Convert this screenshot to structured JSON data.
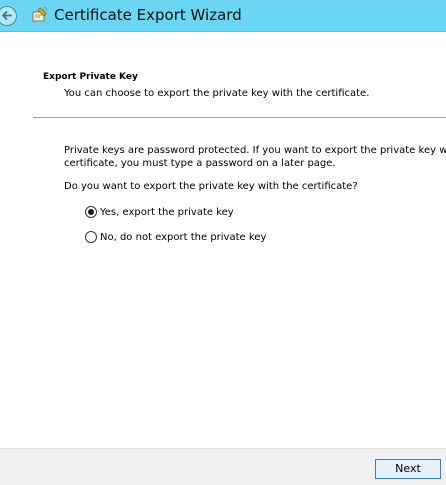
{
  "window": {
    "title": "Certificate Export Wizard",
    "back_icon": "back-arrow-icon",
    "app_icon": "certificate-wizard-icon"
  },
  "header": {
    "heading": "Export Private Key",
    "subheading": "You can choose to export the private key with the certificate."
  },
  "content": {
    "paragraph_line1": "Private keys are password protected. If you want to export the private key with",
    "paragraph_line2": "certificate, you must type a password on a later page.",
    "question": "Do you want to export the private key with the certificate?",
    "options": [
      {
        "label": "Yes, export the private key",
        "selected": true
      },
      {
        "label": "No, do not export the private key",
        "selected": false
      }
    ]
  },
  "footer": {
    "next_label": "Next"
  },
  "colors": {
    "titlebar": "#6ad6f4",
    "footer": "#f0f0f0",
    "button_border": "#3c7fb1"
  }
}
